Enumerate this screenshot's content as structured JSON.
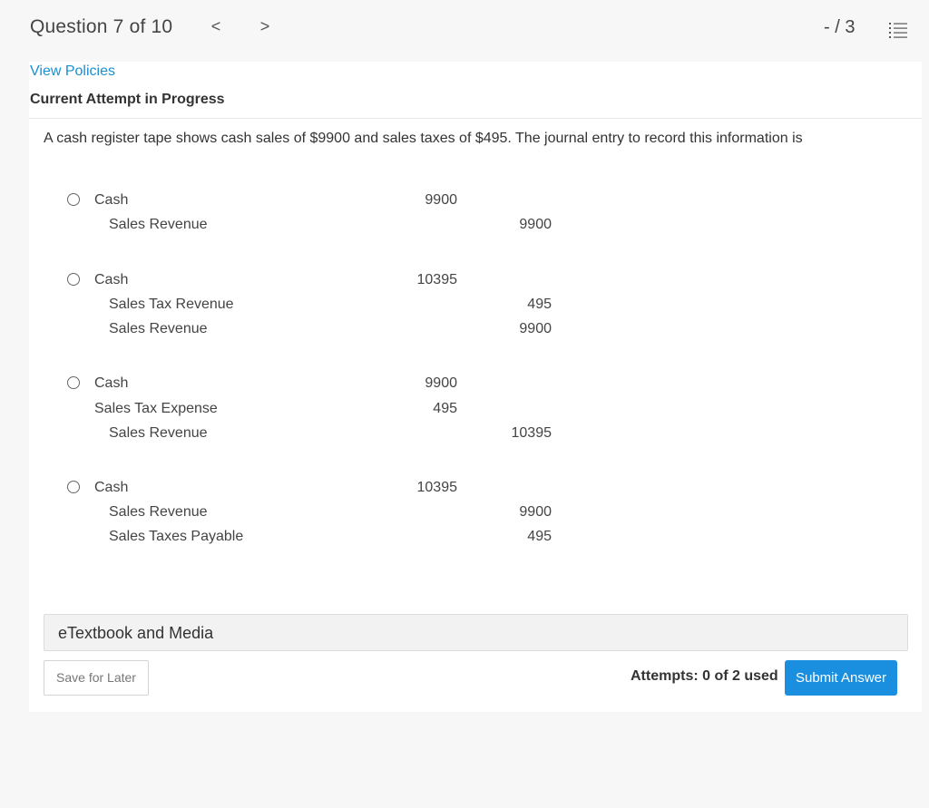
{
  "header": {
    "question_title": "Question 7 of 10",
    "prev_label": "<",
    "next_label": ">",
    "score": "- / 3",
    "list_icon": "list-icon"
  },
  "panel": {
    "policies_link": "View Policies",
    "attempt_heading": "Current Attempt in Progress",
    "question_text": "A cash register tape shows cash sales of $9900 and sales taxes of $495. The journal entry to record this information is"
  },
  "options": [
    {
      "lines": [
        {
          "account": "Cash",
          "debit": "9900",
          "credit": ""
        },
        {
          "account": "Sales Revenue",
          "debit": "",
          "credit": "9900"
        }
      ]
    },
    {
      "lines": [
        {
          "account": "Cash",
          "debit": "10395",
          "credit": ""
        },
        {
          "account": "Sales Tax Revenue",
          "debit": "",
          "credit": "495"
        },
        {
          "account": "Sales Revenue",
          "debit": "",
          "credit": "9900"
        }
      ]
    },
    {
      "lines": [
        {
          "account": "Cash",
          "debit": "9900",
          "credit": ""
        },
        {
          "account": "Sales Tax Expense",
          "debit": "495",
          "credit": ""
        },
        {
          "account": "Sales Revenue",
          "debit": "",
          "credit": "10395"
        }
      ]
    },
    {
      "lines": [
        {
          "account": "Cash",
          "debit": "10395",
          "credit": ""
        },
        {
          "account": "Sales Revenue",
          "debit": "",
          "credit": "9900"
        },
        {
          "account": "Sales Taxes Payable",
          "debit": "",
          "credit": "495"
        }
      ]
    }
  ],
  "footer": {
    "media_label": "eTextbook and Media",
    "save_label": "Save for Later",
    "attempts_text": "Attempts: 0 of 2 used",
    "submit_label": "Submit Answer"
  },
  "colors": {
    "link": "#1a8fd1",
    "submit": "#1a8fe0",
    "background": "#f7f7f7"
  }
}
